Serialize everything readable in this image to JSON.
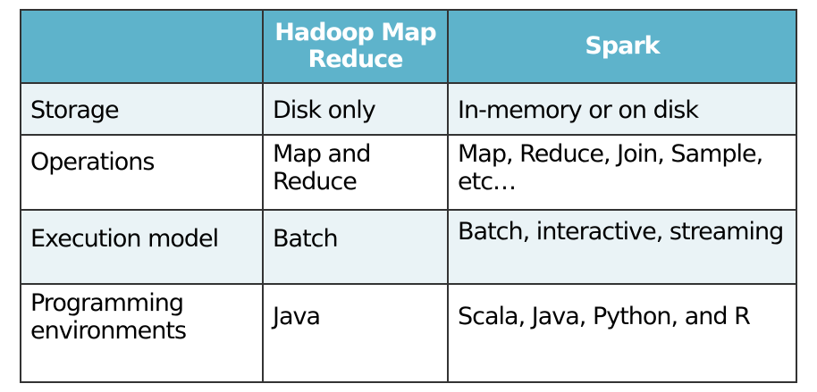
{
  "headers": [
    "",
    "Hadoop Map Reduce",
    "Spark"
  ],
  "rows": [
    {
      "label": "Storage",
      "hadoop": "Disk only",
      "spark": "In-memory or on disk"
    },
    {
      "label": "Operations",
      "hadoop": "Map and Reduce",
      "spark": "Map, Reduce, Join, Sample, etc…"
    },
    {
      "label": "Execution model",
      "hadoop": "Batch",
      "spark": "Batch, interactive, streaming"
    },
    {
      "label": "Programming environments",
      "hadoop": "Java",
      "spark": "Scala, Java, Python, and R"
    }
  ],
  "colors": {
    "header": "#5eb3cb",
    "alt_row": "#eaf3f6"
  }
}
